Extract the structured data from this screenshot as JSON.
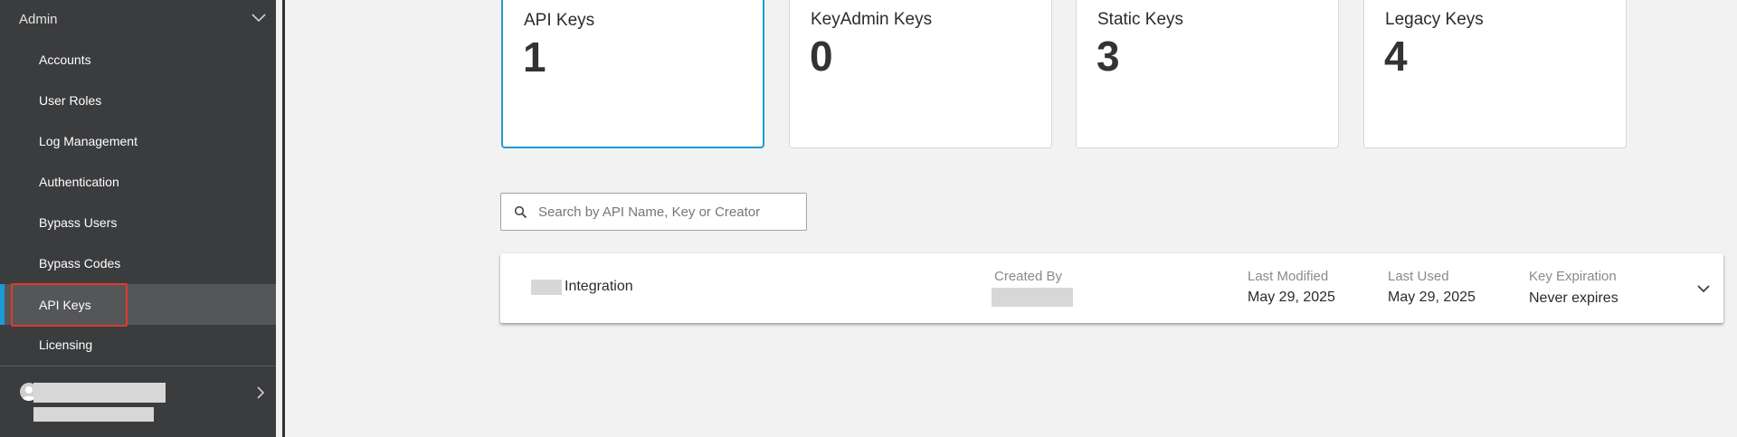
{
  "sidebar": {
    "section_title": "Admin",
    "items": [
      {
        "label": "Accounts"
      },
      {
        "label": "User Roles"
      },
      {
        "label": "Log Management"
      },
      {
        "label": "Authentication"
      },
      {
        "label": "Bypass Users"
      },
      {
        "label": "Bypass Codes"
      },
      {
        "label": "API Keys",
        "active": true
      },
      {
        "label": "Licensing"
      }
    ],
    "active_accent_color": "#1d9bd5",
    "highlight_color": "#e03a2c"
  },
  "summary_cards": [
    {
      "title": "API Keys",
      "count": "1",
      "selected": true
    },
    {
      "title": "KeyAdmin Keys",
      "count": "0"
    },
    {
      "title": "Static Keys",
      "count": "3"
    },
    {
      "title": "Legacy Keys",
      "count": "4"
    }
  ],
  "search": {
    "placeholder": "Search by API Name, Key or Creator",
    "icon": "search-icon"
  },
  "keys_list": {
    "rows": [
      {
        "name": "Integration",
        "created_by_label": "Created By",
        "last_modified_label": "Last Modified",
        "last_modified": "May 29, 2025",
        "last_used_label": "Last Used",
        "last_used": "May 29, 2025",
        "key_expiration_label": "Key Expiration",
        "key_expiration": "Never expires"
      }
    ]
  }
}
